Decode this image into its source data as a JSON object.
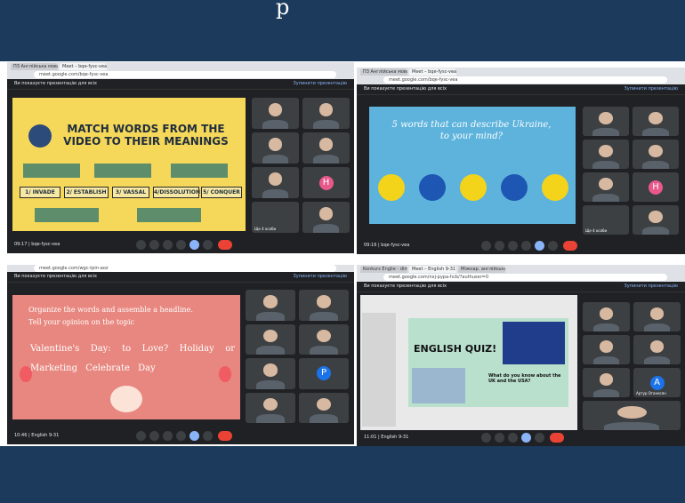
{
  "header": {
    "title_fragment": "p"
  },
  "panels": {
    "p1": {
      "tabs": [
        "ПЗ Англійська мова English...",
        "Meet – bqe-fysc-vea"
      ],
      "url": "meet.google.com/bqe-fysc-vea",
      "presenting": "Ви показуєте презентацію для всіх",
      "stop_presenting": "Зупинити презентацію",
      "slide_title": "MATCH WORDS FROM THE VIDEO TO THEIR MEANINGS",
      "words": [
        "1/ INVADE",
        "2/ ESTABLISH",
        "3/ VASSAL",
        "4/DISSOLUTION",
        "5/ CONQUER"
      ],
      "time": "09:17",
      "meeting": "bqe-fysc-vea",
      "others": "Ще 4 особи"
    },
    "p2": {
      "tabs": [
        "ПЗ Англійська мова English...",
        "Meet – bqe-fysc-vea"
      ],
      "url": "meet.google.com/bqe-fysc-vea",
      "presenting": "Ви показуєте презентацію для всіх",
      "stop_presenting": "Зупинити презентацію",
      "slide_title": "5 words that can describe Ukraine, to your mind?",
      "time": "09:16",
      "meeting": "bqe-fysc-vea",
      "letter": "H",
      "letter2": "H",
      "others": "Ще 4 особи"
    },
    "p3": {
      "url": "meet.google.com/wgc-tpin-aoz",
      "presenting": "Ви показуєте презентацію для всіх",
      "stop_presenting": "Зупинити презентацію",
      "line1": "Organize the words and assemble a headline.",
      "line2": "Tell your opinion on the topic",
      "words": "Valentine's Day: to Love? Holiday or Marketing Celebrate Day",
      "time": "10:46",
      "meeting": "English 9-31",
      "letter": "P"
    },
    "p4": {
      "tabs": [
        "Konkurs Englie - dimple b...",
        "Meet – English 9-31",
        "Міжнар. англійська мова..."
      ],
      "url": "meet.google.com/nxj-pypa-hcb/?authuser=0",
      "presenting": "Ви показуєте презентацію для всіх",
      "stop_presenting": "Зупинити презентацію",
      "slide_title": "ENGLISH QUIZ!",
      "question": "What do you know about the UK and the USA?",
      "time": "11:01",
      "meeting": "English 9-31",
      "letter": "A",
      "name": "Артур Оганесян"
    }
  },
  "colors": {
    "band": "#1b3a5c",
    "meet_dark": "#202124",
    "hangup": "#ea4335",
    "slide_yellow": "#f5d75a",
    "slide_blue": "#5db3dc",
    "slide_pink": "#e8877f",
    "quiz_mint": "#b9e0cd"
  }
}
